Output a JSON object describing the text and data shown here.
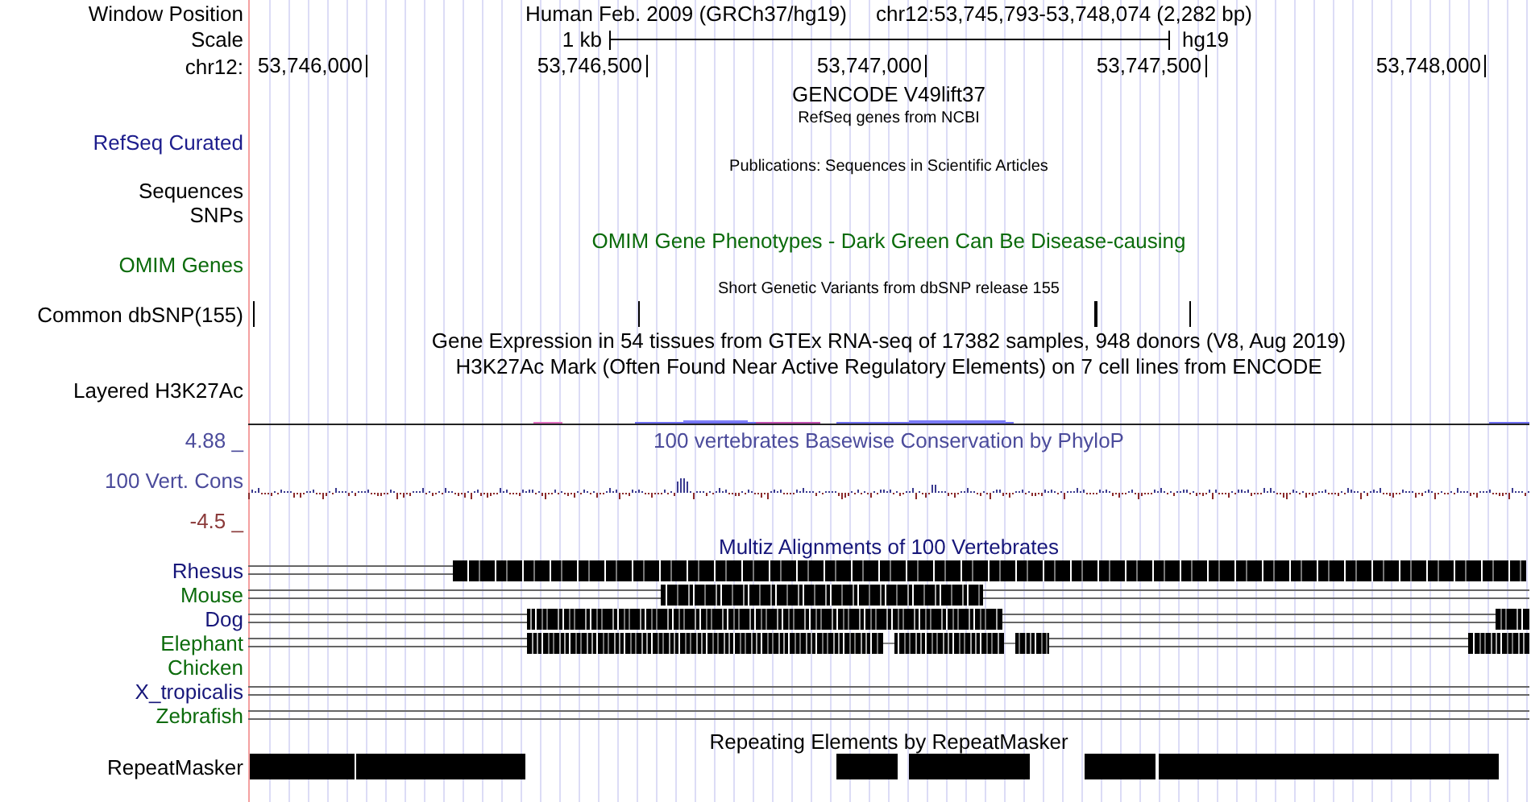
{
  "position": {
    "label": "Window Position",
    "assembly": "Human Feb. 2009 (GRCh37/hg19)",
    "range": "chr12:53,745,793-53,748,074 (2,282 bp)"
  },
  "scale": {
    "label": "Scale",
    "length": "1 kb",
    "assembly": "hg19"
  },
  "ruler": {
    "label": "chr12:",
    "ticks": [
      "53,746,000",
      "53,746,500",
      "53,747,000",
      "53,747,500",
      "53,748,000"
    ]
  },
  "tracks": [
    {
      "kind": "title",
      "title": {
        "text": "GENCODE V49lift37",
        "small": false,
        "color": "#000000"
      }
    },
    {
      "kind": "title",
      "title": {
        "text": "RefSeq genes from NCBI",
        "small": true,
        "color": "#000000"
      }
    },
    {
      "kind": "label",
      "label": {
        "text": "RefSeq Curated",
        "color": "#1c1c8c"
      }
    },
    {
      "kind": "title",
      "title": {
        "text": "Publications: Sequences in Scientific Articles",
        "small": true,
        "color": "#000000"
      }
    },
    {
      "kind": "label",
      "label": {
        "text": "Sequences",
        "color": "#000000"
      }
    },
    {
      "kind": "label",
      "label": {
        "text": "SNPs",
        "color": "#000000"
      }
    },
    {
      "kind": "title",
      "title": {
        "text": "OMIM Gene Phenotypes - Dark Green Can Be Disease-causing",
        "small": false,
        "color": "#0b6b0b"
      }
    },
    {
      "kind": "label",
      "label": {
        "text": "OMIM Genes",
        "color": "#0b6b0b"
      }
    },
    {
      "kind": "title",
      "title": {
        "text": "Short Genetic Variants from dbSNP release 155",
        "small": true,
        "color": "#000000"
      }
    },
    {
      "kind": "snps",
      "label": {
        "text": "Common dbSNP(155)",
        "color": "#000000"
      }
    },
    {
      "kind": "title",
      "title": {
        "text": "Gene Expression in 54 tissues from GTEx RNA-seq of 17382 samples, 948 donors (V8, Aug 2019)",
        "small": false,
        "color": "#000000"
      }
    },
    {
      "kind": "title",
      "title": {
        "text": "H3K27Ac Mark (Often Found Near Active Regulatory Elements) on 7 cell lines from ENCODE",
        "small": false,
        "color": "#000000"
      }
    },
    {
      "kind": "label",
      "label": {
        "text": "Layered H3K27Ac",
        "color": "#000000"
      }
    },
    {
      "kind": "signal"
    },
    {
      "kind": "title",
      "label": {
        "text": "4.88 _",
        "color": "#4b4b9b"
      },
      "title": {
        "text": "100 vertebrates Basewise Conservation by PhyloP",
        "small": false,
        "color": "#4b4b9b"
      }
    },
    {
      "kind": "wiggle",
      "label": {
        "text": "100 Vert. Cons",
        "color": "#4b4b9b"
      }
    },
    {
      "kind": "label",
      "label": {
        "text": "-4.5 _",
        "color": "#8b3a3a"
      }
    },
    {
      "kind": "title",
      "title": {
        "text": "Multiz Alignments of 100 Vertebrates",
        "small": false,
        "color": "#16167a"
      }
    },
    {
      "kind": "species",
      "label": {
        "text": "Rhesus",
        "color": "#16167a"
      }
    },
    {
      "kind": "species",
      "label": {
        "text": "Mouse",
        "color": "#0b6b0b"
      }
    },
    {
      "kind": "species",
      "label": {
        "text": "Dog",
        "color": "#16167a"
      }
    },
    {
      "kind": "species",
      "label": {
        "text": "Elephant",
        "color": "#0b6b0b"
      }
    },
    {
      "kind": "species",
      "label": {
        "text": "Chicken",
        "color": "#0b6b0b"
      }
    },
    {
      "kind": "species",
      "label": {
        "text": "X_tropicalis",
        "color": "#16167a"
      }
    },
    {
      "kind": "species",
      "label": {
        "text": "Zebrafish",
        "color": "#0b6b0b"
      }
    },
    {
      "kind": "title",
      "title": {
        "text": "Repeating Elements by RepeatMasker",
        "small": false,
        "color": "#000000"
      }
    },
    {
      "kind": "repeats",
      "label": {
        "text": "RepeatMasker",
        "color": "#000000"
      }
    }
  ]
}
